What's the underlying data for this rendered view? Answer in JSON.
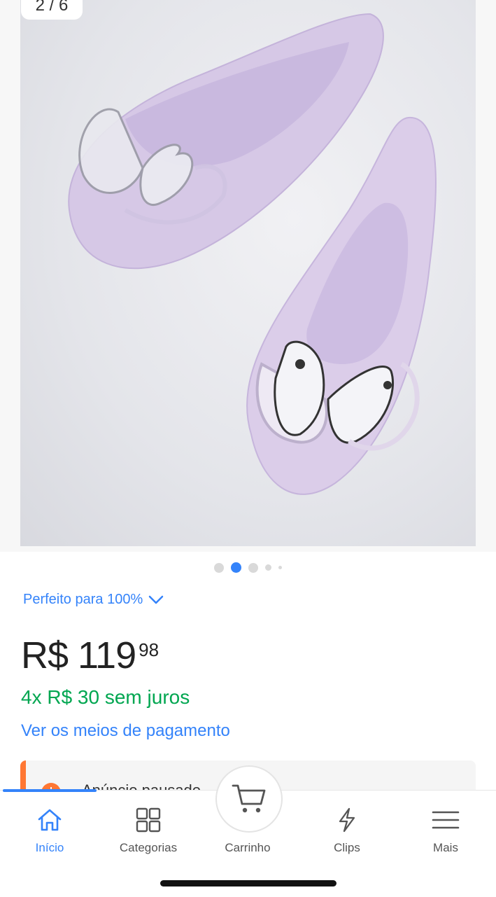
{
  "gallery": {
    "counter": "2 / 6",
    "dots_count": 5,
    "active_dot": 1
  },
  "product": {
    "fit_label": "Perfeito para 100%",
    "price_main": "R$ 119",
    "price_cents": "98",
    "installments": "4x R$ 30 sem juros",
    "payment_link": "Ver os meios de pagamento",
    "notice": "Anúncio pausado"
  },
  "nav": {
    "home": "Início",
    "categories": "Categorias",
    "cart": "Carrinho",
    "clips": "Clips",
    "more": "Mais"
  },
  "colors": {
    "accent": "#3483fa",
    "installments_green": "#00a650",
    "notice_orange": "#ff7733"
  },
  "icons": [
    "home-icon",
    "categories-icon",
    "cart-icon",
    "clips-icon",
    "menu-icon",
    "chevron-down-icon",
    "warning-icon"
  ]
}
